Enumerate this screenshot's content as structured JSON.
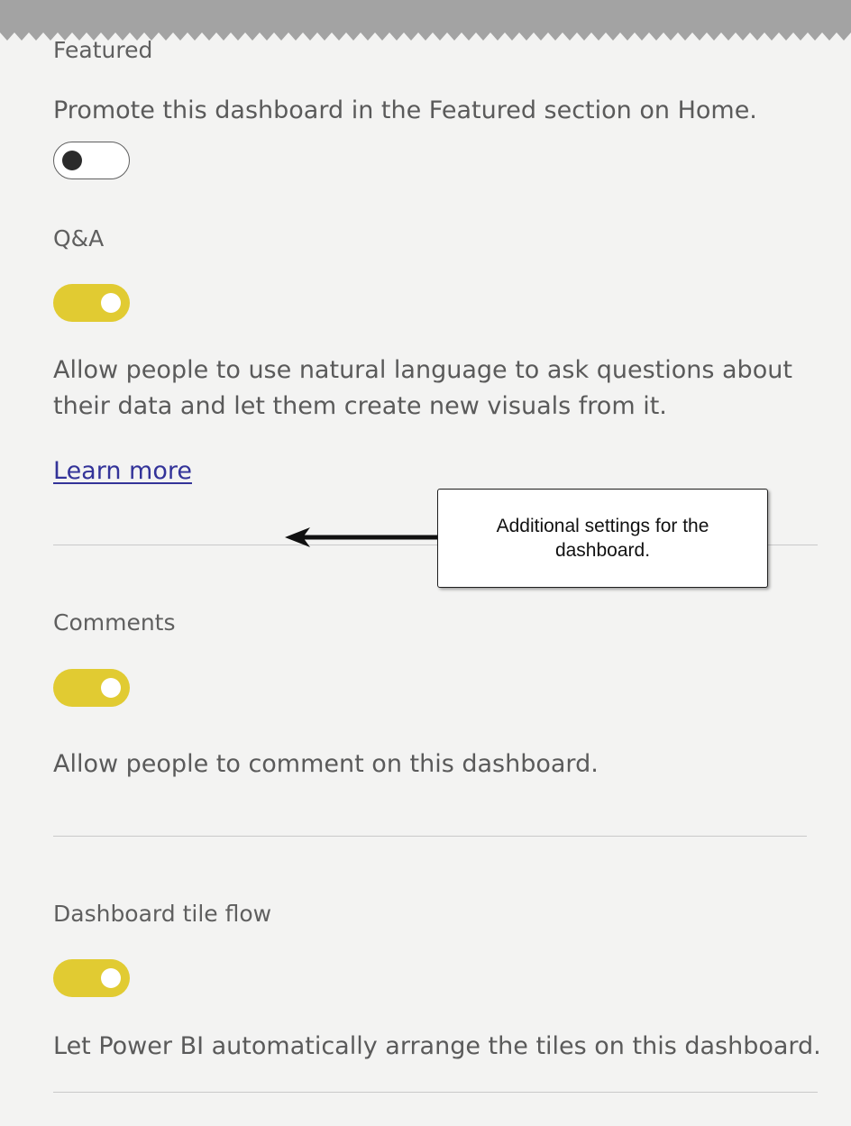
{
  "featured": {
    "title": "Featured",
    "description": "Promote this dashboard in the Featured section on Home.",
    "enabled": false
  },
  "qna": {
    "title": "Q&A",
    "enabled": true,
    "description_line1": "Allow people to use natural language to ask questions about",
    "description_line2": "their data and let them create new visuals from it.",
    "learn_more": "Learn more"
  },
  "comments": {
    "title": "Comments",
    "enabled": true,
    "description": "Allow people to comment on this dashboard."
  },
  "tile_flow": {
    "title": "Dashboard tile flow",
    "enabled": true,
    "description": "Let Power BI automatically arrange the tiles on this dashboard."
  },
  "callout": {
    "text": "Additional settings for the dashboard."
  },
  "colors": {
    "toggle_on": "#e1cb32",
    "link": "#333399",
    "text": "#5c5c5c",
    "background": "#f3f3f2"
  }
}
